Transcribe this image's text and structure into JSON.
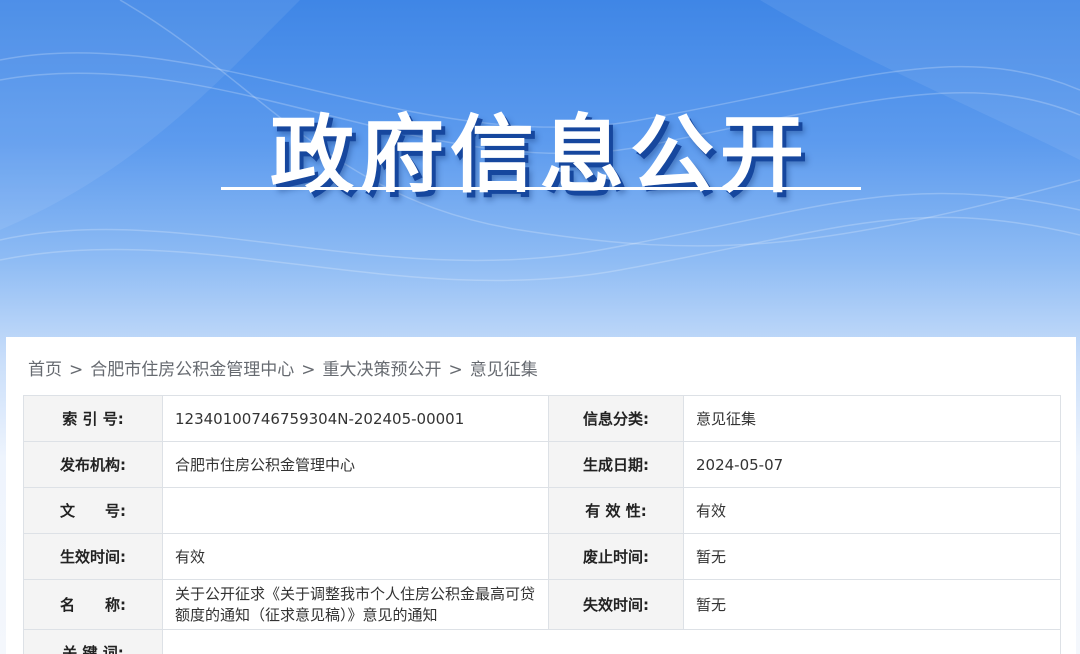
{
  "banner": {
    "title": "政府信息公开"
  },
  "breadcrumb": {
    "items": [
      "首页",
      "合肥市住房公积金管理中心",
      "重大决策预公开",
      "意见征集"
    ],
    "separator": ">"
  },
  "info_table": {
    "rows": [
      {
        "label1": "索 引 号:",
        "value1": "12340100746759304N-202405-00001",
        "label2": "信息分类:",
        "value2": "意见征集"
      },
      {
        "label1": "发布机构:",
        "value1": "合肥市住房公积金管理中心",
        "label2": "生成日期:",
        "value2": "2024-05-07"
      },
      {
        "label1": "文　　号:",
        "value1": "",
        "label2": "有 效 性:",
        "value2": "有效"
      },
      {
        "label1": "生效时间:",
        "value1": "有效",
        "label2": "废止时间:",
        "value2": "暂无"
      },
      {
        "label1": "名　　称:",
        "value1": "关于公开征求《关于调整我市个人住房公积金最高可贷额度的通知（征求意见稿）》意见的通知",
        "label2": "失效时间:",
        "value2": "暂无"
      },
      {
        "label1": "关 键 词:",
        "value1": "",
        "label2": "",
        "value2": ""
      }
    ]
  }
}
